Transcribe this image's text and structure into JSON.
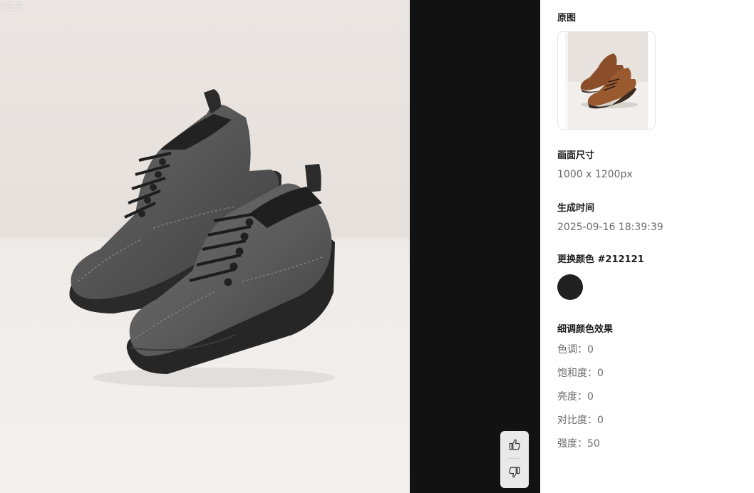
{
  "viewer": {
    "watermark": "AI生成",
    "image_subject": "gray-leather-shoes",
    "feedback": {
      "like_icon": "thumbs-up-icon",
      "dislike_icon": "thumbs-down-icon"
    }
  },
  "panel": {
    "original": {
      "label": "原图"
    },
    "size": {
      "label": "画面尺寸",
      "value": "1000 x 1200px"
    },
    "time": {
      "label": "生成时间",
      "value": "2025-09-16 18:39:39"
    },
    "color": {
      "label": "更换颜色 #212121",
      "swatch": "#212121"
    },
    "adjust": {
      "label": "细调颜色效果",
      "hue": "色调：0",
      "saturation": "饱和度：0",
      "brightness": "亮度：0",
      "contrast": "对比度：0",
      "strength": "强度：50"
    }
  },
  "colors": {
    "viewer_bg": "#121212",
    "panel_bg": "#ffffff",
    "text_primary": "#1f1f1f",
    "text_secondary": "#6b6b6b"
  }
}
